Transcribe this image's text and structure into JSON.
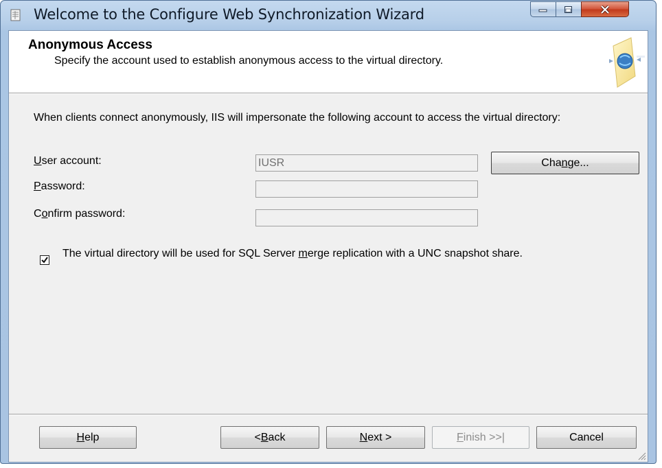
{
  "window": {
    "title": "Welcome to the Configure Web Synchronization Wizard"
  },
  "header": {
    "title": "Anonymous Access",
    "description": "Specify the account used to establish anonymous access to the virtual directory."
  },
  "body": {
    "intro": "When clients connect anonymously, IIS will impersonate the following account to access the virtual directory:"
  },
  "fields": {
    "user_account": {
      "label_pre": "",
      "label_key": "U",
      "label_post": "ser account:",
      "value": "IUSR"
    },
    "password": {
      "label_pre": "",
      "label_key": "P",
      "label_post": "assword:",
      "value": ""
    },
    "confirm_password": {
      "label_pre": "C",
      "label_key": "o",
      "label_post": "nfirm password:",
      "value": ""
    }
  },
  "change_button": {
    "pre": "Cha",
    "key": "n",
    "post": "ge..."
  },
  "merge_checkbox": {
    "checked": true,
    "label_pre": "The virtual directory will be used for SQL Server ",
    "label_key": "m",
    "label_post": "erge replication with a UNC snapshot share."
  },
  "footer": {
    "help": {
      "pre": "",
      "key": "H",
      "post": "elp"
    },
    "back": {
      "pre": "< ",
      "key": "B",
      "post": "ack"
    },
    "next": {
      "pre": "",
      "key": "N",
      "post": "ext >"
    },
    "finish": {
      "pre": "",
      "key": "F",
      "post": "inish >>|",
      "disabled": true
    },
    "cancel": {
      "label": "Cancel"
    }
  }
}
